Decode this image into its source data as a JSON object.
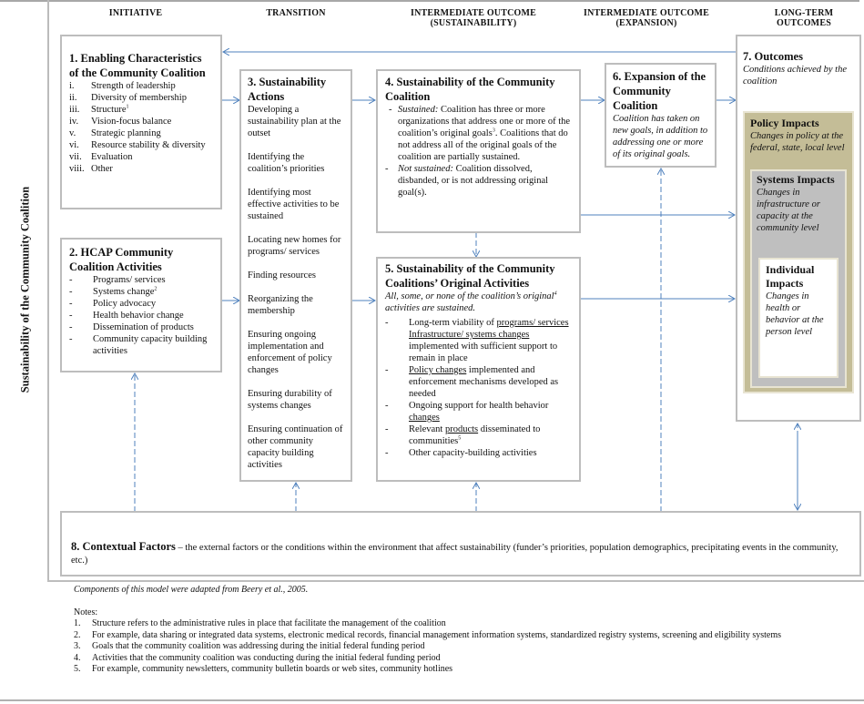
{
  "side_title": "Sustainability of the Community Coalition",
  "columns": [
    {
      "line1": "INITIATIVE",
      "line2": ""
    },
    {
      "line1": "TRANSITION",
      "line2": ""
    },
    {
      "line1": "INTERMEDIATE OUTCOME",
      "line2": "(SUSTAINABILITY)"
    },
    {
      "line1": "INTERMEDIATE OUTCOME",
      "line2": "(EXPANSION)"
    },
    {
      "line1": "LONG-TERM",
      "line2": "OUTCOMES"
    }
  ],
  "box1": {
    "title": "1.   Enabling Characteristics of the Community Coalition",
    "items": [
      {
        "marker": "i.",
        "text": "Strength of leadership",
        "sup": ""
      },
      {
        "marker": "ii.",
        "text": "Diversity of membership",
        "sup": ""
      },
      {
        "marker": "iii.",
        "text": "Structure",
        "sup": "1"
      },
      {
        "marker": "iv.",
        "text": "Vision-focus balance",
        "sup": ""
      },
      {
        "marker": "v.",
        "text": "Strategic planning",
        "sup": ""
      },
      {
        "marker": "vi.",
        "text": "Resource stability & diversity",
        "sup": ""
      },
      {
        "marker": "vii.",
        "text": "Evaluation",
        "sup": ""
      },
      {
        "marker": "viii.",
        "text": "Other",
        "sup": ""
      }
    ]
  },
  "box2": {
    "title": "2. HCAP Community Coalition Activities",
    "items": [
      {
        "text": "Programs/ services",
        "sup": ""
      },
      {
        "text": "Systems change",
        "sup": "2"
      },
      {
        "text": "Policy advocacy",
        "sup": ""
      },
      {
        "text": "Health behavior change",
        "sup": ""
      },
      {
        "text": "Dissemination of products",
        "sup": ""
      },
      {
        "text": "Community capacity building activities",
        "sup": ""
      }
    ]
  },
  "box3": {
    "title": "3. Sustainability Actions",
    "items": [
      "Developing a sustainability plan at the outset",
      "Identifying the coalition’s priorities",
      "Identifying most effective activities to be sustained",
      "Locating new homes for programs/ services",
      "Finding resources",
      "Reorganizing the membership",
      "Ensuring ongoing implementation and enforcement of policy changes",
      "Ensuring durability of systems changes",
      "Ensuring continuation of other community capacity building activities"
    ]
  },
  "box4": {
    "title": "4. Sustainability of the Community Coalition",
    "sustained_label": "Sustained:",
    "sustained_text": " Coalition has three or more organizations that address one or more of the coalition’s original goals",
    "sustained_sup": "3",
    "sustained_text2": ". Coalitions that do not address all of the original goals of the coalition are partially sustained.",
    "not_sustained_label": "Not sustained:",
    "not_sustained_text": " Coalition dissolved, disbanded, or is not addressing original goal(s)."
  },
  "box5": {
    "title": "5. Sustainability of the Community Coalitions’ Original Activities",
    "intro_a": "All, some, or none of the coalition’s original",
    "intro_sup": "4",
    "intro_b": " activities are sustained.",
    "item1_u": "programs/ services Infrastructure/ systems changes",
    "item1_pre": "Long-term viability of ",
    "item1_post": " implemented with sufficient support to remain in place",
    "item2_u": "Policy changes",
    "item2_post": " implemented and enforcement mechanisms developed as needed",
    "item3_pre": "Ongoing support for health behavior ",
    "item3_u": "changes",
    "item4_pre": "Relevant ",
    "item4_u": "products",
    "item4_post": " disseminated to communities",
    "item4_sup": "5",
    "item5": "Other capacity-building activities"
  },
  "box6": {
    "title": "6. Expansion of the Community Coalition",
    "desc": "Coalition has taken on new goals, in addition to addressing one or more of its original goals."
  },
  "box7": {
    "title": "7. Outcomes",
    "desc": "Conditions achieved by the coalition",
    "policy_title": "Policy Impacts",
    "policy_desc": "Changes in policy at the federal, state, local level",
    "systems_title": "Systems Impacts",
    "systems_desc": "Changes in infrastructure or capacity at the community level",
    "individual_title": "Individual Impacts",
    "individual_desc": "Changes in health or behavior at the person level",
    "colors": {
      "policy": "#c4bd97",
      "systems": "#bfbfbf",
      "individual": "#ffffff"
    }
  },
  "box8": {
    "title": "8. Contextual Factors",
    "text": " – the external factors or the conditions within the environment that affect sustainability (funder’s priorities, population demographics, precipitating events in the community, etc.)"
  },
  "footer": {
    "source": "Components of this model were adapted from Beery et al., 2005.",
    "notes_label": "Notes:",
    "notes": [
      {
        "n": "1.",
        "text": "Structure refers to the administrative rules in place that facilitate the management of the coalition"
      },
      {
        "n": "2.",
        "text": "For example, data sharing or integrated data systems, electronic medical records, financial management information systems, standardized registry systems, screening and eligibility  systems"
      },
      {
        "n": "3.",
        "text": "Goals that the community coalition was addressing during the initial federal funding period"
      },
      {
        "n": "4.",
        "text": "Activities that the community coalition was conducting during the initial federal funding period"
      },
      {
        "n": "5.",
        "text": "For example, community newsletters, community bulletin boards or web sites, community hotlines"
      }
    ]
  },
  "colors": {
    "arrow": "#4f81bd",
    "box_border": "#bdbdbd"
  }
}
